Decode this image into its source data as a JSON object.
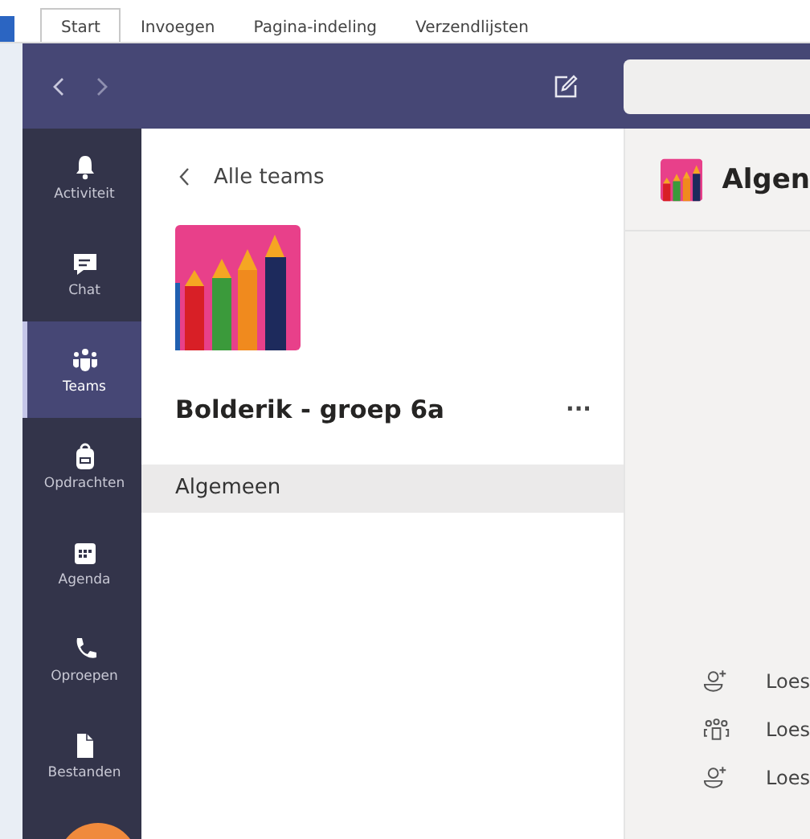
{
  "ribbon": {
    "tabs": [
      {
        "label": "Start",
        "selected": true
      },
      {
        "label": "Invoegen",
        "selected": false
      },
      {
        "label": "Pagina-indeling",
        "selected": false
      },
      {
        "label": "Verzendlijsten",
        "selected": false
      }
    ]
  },
  "rail": {
    "items": [
      {
        "kind": "bell",
        "label": "Activiteit",
        "selected": false
      },
      {
        "kind": "chat",
        "label": "Chat",
        "selected": false
      },
      {
        "kind": "teams",
        "label": "Teams",
        "selected": true
      },
      {
        "kind": "bag",
        "label": "Opdrachten",
        "selected": false
      },
      {
        "kind": "calendar",
        "label": "Agenda",
        "selected": false
      },
      {
        "kind": "phone",
        "label": "Oproepen",
        "selected": false
      },
      {
        "kind": "file",
        "label": "Bestanden",
        "selected": false
      }
    ]
  },
  "panel": {
    "back": "Alle teams",
    "team_name": "Bolderik - groep 6a",
    "more": "···",
    "channels": [
      {
        "name": "Algemeen",
        "selected": true
      }
    ]
  },
  "channel": {
    "title": "Algen",
    "activity": [
      {
        "kind": "add-person",
        "text": "Loes"
      },
      {
        "kind": "group",
        "text": "Loes"
      },
      {
        "kind": "add-person",
        "text": "Loes"
      }
    ]
  }
}
